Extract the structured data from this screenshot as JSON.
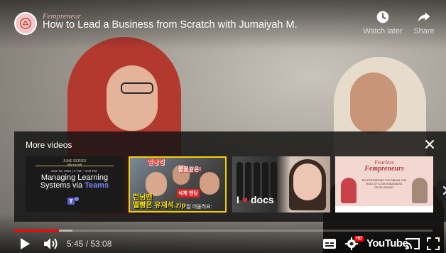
{
  "channel": {
    "name": "Fempreneur"
  },
  "video": {
    "title": "How to Lead a Business from Scratch with Jumaiyah M."
  },
  "header_actions": {
    "watch_later": "Watch later",
    "share": "Share"
  },
  "more_videos": {
    "heading": "More videos",
    "items": [
      {
        "kicker": "JUNE SERIES",
        "kicker2": "Microsoft",
        "date": "June 06, 2021 | 2 PM – 4:00 PM",
        "line1": "Managing Learning",
        "line2_plain": "Systems via ",
        "line2_accent": "Teams"
      },
      {
        "top_text": "멜빵킹",
        "top_text2": "불꽃같은!",
        "mid_text": "삭제 엔딩",
        "bottom_line1": "런닝맨",
        "bottom_line2": "멜빵은 유재석.zip",
        "bottom_small": "'잘 어울려요'"
      },
      {
        "word_prefix": "I ",
        "word_heart": "♥",
        "word_suffix": " docs"
      },
      {
        "brand_line1": "Fearless",
        "brand_line2": "Fempreneurs",
        "text": "BOOTSTRAPPING THE DREAM: THE ROLE OF A JOB IN BUSINESS DEVELOPMENT"
      }
    ]
  },
  "player": {
    "current_time": "5:45",
    "duration": "53:08",
    "time_display": "5:45 / 53:08",
    "progress_fraction": 0.108,
    "buffer_fraction": 0.14,
    "hd_badge": "HD",
    "logo_text": "YouTube"
  },
  "colors": {
    "progress": "#ff0000",
    "accent_teams": "#7c86ff",
    "brand_pink": "#b23a3a"
  }
}
